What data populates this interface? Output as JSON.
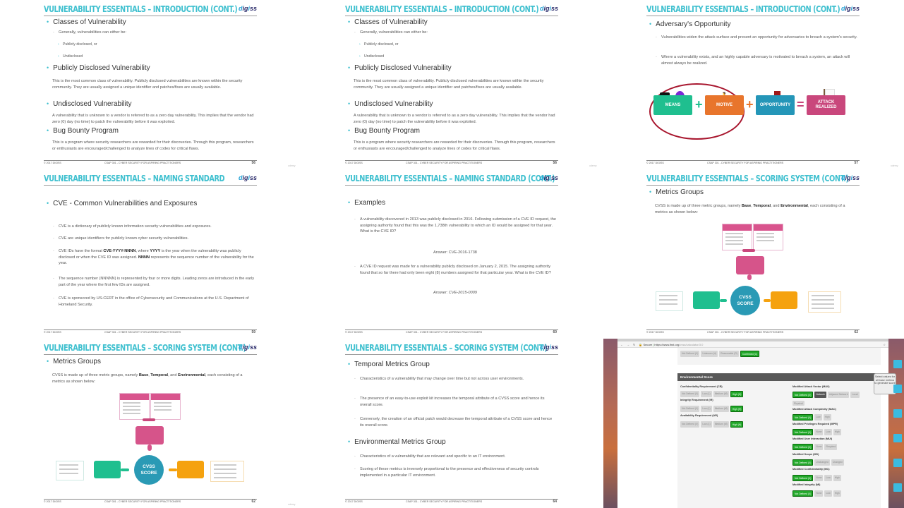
{
  "common": {
    "logo": "digiss",
    "footer_left": "© 2017 DIGISS",
    "footer_center": "CSAP 301 - CYBER SECURITY FOR ASPIRING PRACTITIONERS",
    "watermark": "udemy"
  },
  "slides": [
    {
      "title": "VULNERABILITY ESSENTIALS – INTRODUCTION (CONT.)",
      "page": "56",
      "sections": [
        {
          "heading": "Classes of Vulnerability",
          "intro": "Generally, vulnerabilities can either be:",
          "items": [
            "Publicly disclosed, or",
            "Undisclosed"
          ]
        },
        {
          "heading": "Publicly Disclosed Vulnerability",
          "body": "This is the most common class of vulnerability. Publicly disclosed vulnerabilities are known within the security community. They are usually assigned a unique identifier and patches/fixes are usually available."
        },
        {
          "heading": "Undisclosed Vulnerability",
          "body": "A vulnerability that is unknown to a vendor is referred to as a zero day vulnerability. This implies that the vendor had zero (0) day (no time) to patch the vulnerability before it was exploited."
        },
        {
          "heading": "Bug Bounty Program",
          "body": "This is a program where security researchers are rewarded for their discoveries. Through this program, researchers or enthusiasts are encouraged/challenged to analyze lines of codes for critical flaws."
        }
      ]
    },
    {
      "title": "VULNERABILITY ESSENTIALS – INTRODUCTION (CONT.)",
      "page": "56"
    },
    {
      "title": "VULNERABILITY ESSENTIALS – INTRODUCTION (CONT.)",
      "page": "57",
      "heading": "Adversary's Opportunity",
      "points": [
        "Vulnerabilities widen the attack surface and present an opportunity for adversaries to breach a system's security.",
        "Where a vulnerability exists, and an highly capable adversary is motivated to breach a system, an attack will almost always be realized."
      ],
      "equation": {
        "means": "MEANS",
        "motive": "MOTIVE",
        "opportunity": "OPPORTUNITY",
        "result": "ATTACK REALIZED",
        "plus": "+",
        "equals": "="
      }
    },
    {
      "title": "VULNERABILITY ESSENTIALS – NAMING STANDARD",
      "page": "59",
      "heading": "CVE - Common Vulnerabilities and Exposures",
      "points": [
        "CVE is a dictionary of publicly known information security vulnerabilities and exposures.",
        "CVE are unique identifiers for publicly known cyber security vulnerabilities.",
        "The sequence number (NNNNN) is represented by four or more digits. Leading zeros are introduced in the early part of the year where the first few IDs are assigned.",
        "CVE is sponsored by US-CERT in the office of Cybersecurity and Communications at the U.S. Department of Homeland Security."
      ],
      "format_point": {
        "a": "CVE IDs have the format ",
        "b": "CVE-YYYY-NNNN",
        "c": ", where ",
        "d": "YYYY",
        "e": " is the year when the vulnerability was publicly disclosed or when the CVE ID was assigned. ",
        "f": "NNNN",
        "g": " represents the sequence number of the vulnerability for the year."
      }
    },
    {
      "title": "VULNERABILITY ESSENTIALS – NAMING STANDARD (CONT.)",
      "page": "60",
      "heading": "Examples",
      "example1": "A vulnerability discovered in 2013 was publicly disclosed in 2016. Following submission of a CVE ID request, the assigning authority found that this was the 1,738th vulnerability to which an ID would be assigned for that year. What is the CVE ID?",
      "answer1": "Answer: CVE-2016-1738",
      "example2": "A CVE ID request was made for a vulnerability publicly disclosed on January 2, 2015. The assigning authority found that so far there had only been eight (8) numbers assigned for that particular year. What is the CVE ID?",
      "answer2": "Answer: CVE-2015-0009"
    },
    {
      "title": "VULNERABILITY ESSENTIALS – SCORING SYSTEM (CONT.)",
      "page": "62",
      "heading": "Metrics Groups",
      "body_a": "CVSS is made up of three metric groups, namely ",
      "body_b": "Base",
      "body_c": ", ",
      "body_d": "Temporal",
      "body_e": ", and ",
      "body_f": "Environmental",
      "body_g": ", each consisting of a metrics as shown below:",
      "cvss": {
        "score_label": "CVSS SCORE"
      }
    },
    {
      "title": "VULNERABILITY ESSENTIALS – SCORING SYSTEM (CONT.)",
      "page": "62"
    },
    {
      "title": "VULNERABILITY ESSENTIALS – SCORING SYSTEM (CONT.)",
      "page": "64",
      "heading1": "Temporal Metrics Group",
      "points1": [
        "Characteristics of a vulnerability that may change over time but not across user environments.",
        "The presence of an easy-to-use exploit kit increases the temporal attribute of a CVSS score and hence its overall score.",
        "Conversely, the creation of an official patch would decrease the temporal attribute of a CVSS score and hence its overall score."
      ],
      "heading2": "Environmental Metrics Group",
      "points2": [
        "Characteristics of a vulnerability that are relevant and specific to an IT environment.",
        "Scoring of these metrics is inversely proportional to the presence and effectiveness of security controls implemented in a particular IT environment."
      ]
    }
  ],
  "browser": {
    "secure_label": "Secure",
    "url_host": "https://www.first.org",
    "url_path": "/cvss/calculator/3.0",
    "top_row": [
      "Not Defined (X)",
      "Unknown (U)",
      "Reasonable (R)",
      "Confirmed (C)"
    ],
    "section_title": "Environmental Score",
    "tooltip": "Select values for all base metrics to generate score",
    "left_metrics": [
      {
        "label": "Confidentiality Requirement (CR)",
        "options": [
          "Not Defined (X)",
          "Low (L)",
          "Medium (M)",
          "High (H)"
        ]
      },
      {
        "label": "Integrity Requirement (IR)",
        "options": [
          "Not Defined (X)",
          "Low (L)",
          "Medium (M)",
          "High (H)"
        ]
      },
      {
        "label": "Availability Requirement (AR)",
        "options": [
          "Not Defined (X)",
          "Low (L)",
          "Medium (M)",
          "High (H)"
        ]
      }
    ],
    "right_metrics": [
      {
        "label": "Modified Attack Vector (MAV)",
        "options": [
          "Not Defined (X)",
          "Network",
          "Adjacent Network",
          "Local",
          "Physical"
        ]
      },
      {
        "label": "Modified Attack Complexity (MAC)",
        "options": [
          "Not Defined (X)",
          "Low",
          "High"
        ]
      },
      {
        "label": "Modified Privileges Required (MPR)",
        "options": [
          "Not Defined (X)",
          "None",
          "Low",
          "High"
        ]
      },
      {
        "label": "Modified User Interaction (MUI)",
        "options": [
          "Not Defined (X)",
          "None",
          "Required"
        ]
      },
      {
        "label": "Modified Scope (MS)",
        "options": [
          "Not Defined (X)",
          "Unchanged",
          "Changed"
        ]
      },
      {
        "label": "Modified Confidentiality (MC)",
        "options": [
          "Not Defined (X)",
          "None",
          "Low",
          "High"
        ]
      },
      {
        "label": "Modified Integrity (MI)",
        "options": [
          "Not Defined (X)",
          "None",
          "Low",
          "High"
        ]
      }
    ]
  }
}
